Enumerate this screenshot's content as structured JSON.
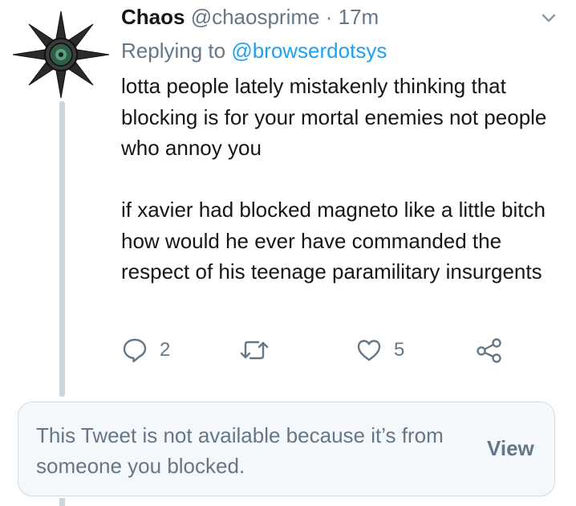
{
  "tweet": {
    "author_name": "Chaos",
    "author_handle": "@chaosprime",
    "separator": "·",
    "time": "17m",
    "replying_prefix": "Replying to",
    "replying_to": "@browserdotsys",
    "text_paragraphs": [
      "lotta people lately mistakenly thinking that blocking is for your mortal enemies not people who annoy you",
      "if xavier had blocked magneto like a little bitch how would he ever have commanded the respect of his teenage paramilitary insurgents"
    ],
    "reply_count": "2",
    "like_count": "5",
    "icons": {
      "reply": "reply-bubble-icon",
      "retweet": "retweet-icon",
      "like": "heart-icon",
      "share": "share-icon",
      "menu": "chevron-down-icon"
    }
  },
  "blocked_notice": {
    "text": "This Tweet is not available because it’s from someone you blocked.",
    "view_label": "View"
  },
  "colors": {
    "text": "#14171a",
    "secondary": "#657786",
    "link": "#1da1f2",
    "thread_line": "#cdd5dc",
    "card_bg": "#f5f8fa",
    "card_border": "#d2dbe2"
  }
}
